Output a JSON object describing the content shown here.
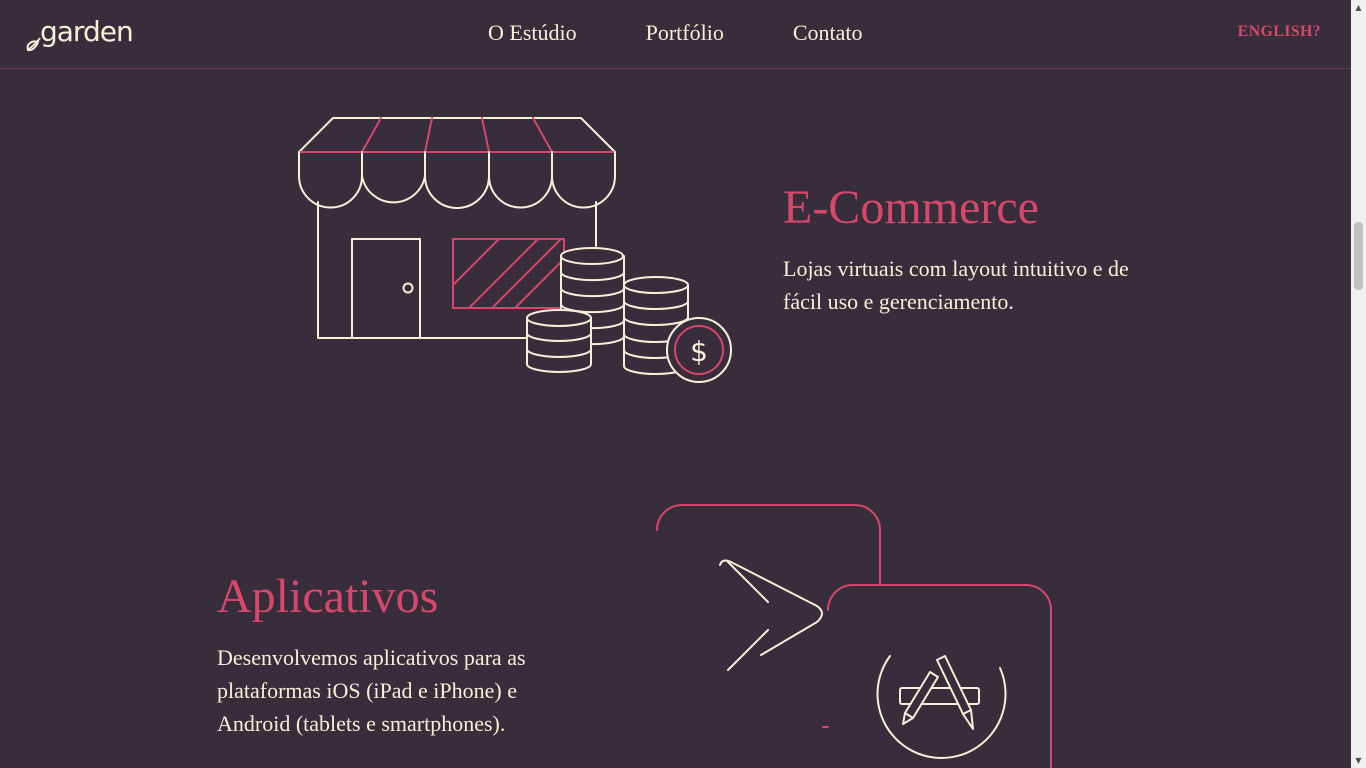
{
  "header": {
    "logo_text": "garden",
    "nav": [
      {
        "label": "O Estúdio"
      },
      {
        "label": "Portfólio"
      },
      {
        "label": "Contato"
      }
    ],
    "language_toggle": "ENGLISH?"
  },
  "sections": {
    "ecommerce": {
      "title": "E-Commerce",
      "description": "Lojas virtuais com layout intuitivo e de fácil uso e gerenciamento.",
      "illustration_icon": "storefront-with-coins-icon",
      "coin_symbol": "$"
    },
    "apps": {
      "title": "Aplicativos",
      "description": "Desenvolvemos aplicativos para as plataformas iOS (iPad e iPhone) e Android (tablets e smartphones).",
      "illustration_icon": "play-store-and-app-store-icon"
    }
  },
  "colors": {
    "background": "#382d3b",
    "accent": "#d6476b",
    "text": "#f7f0d9"
  }
}
